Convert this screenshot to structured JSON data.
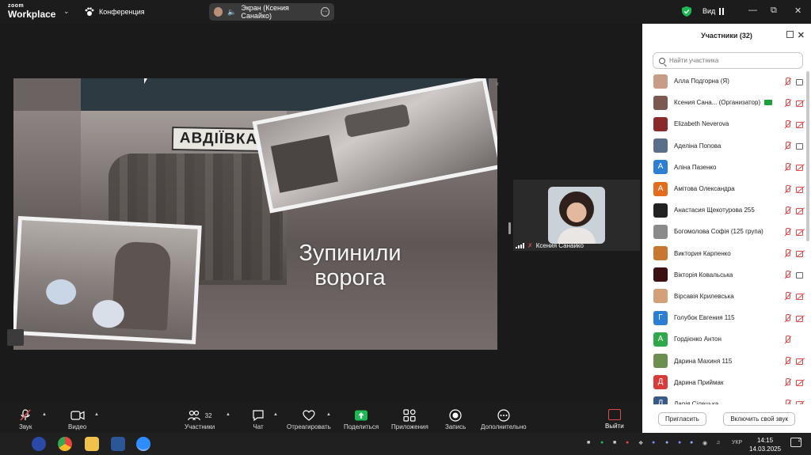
{
  "app": {
    "brand_top": "zoom",
    "brand_bottom": "Workplace",
    "meeting_label": "Конференция",
    "share_label": "Экран (Ксения Санайко)",
    "view_label": "Вид"
  },
  "slide": {
    "sign_text": "АВДІЇВКА",
    "caption_line1": "Зупинили",
    "caption_line2": "ворога"
  },
  "video_tile": {
    "name": "Ксения Санайко"
  },
  "participants": {
    "title": "Участники (32)",
    "search_placeholder": "Найти участника",
    "invite_label": "Пригласить",
    "unmute_label": "Включить свой звук",
    "rows": [
      {
        "name": "Алла Подгорна (Я)",
        "avatar": "",
        "avatar_color": "#c79d87",
        "cam": "on"
      },
      {
        "name": "Ксения Сана... (Организатор)",
        "avatar": "",
        "avatar_color": "#7a5a50",
        "cam": "off",
        "badge": true
      },
      {
        "name": "Elizabeth Neverova",
        "avatar": "",
        "avatar_color": "#8b2a2a",
        "cam": "off"
      },
      {
        "name": "Аделіна Попова",
        "avatar": "",
        "avatar_color": "#5c6f8a",
        "cam": "on"
      },
      {
        "name": "Аліна Пазенко",
        "avatar": "А",
        "avatar_color": "#2d7fd3",
        "cam": "off"
      },
      {
        "name": "Амітова Олександра",
        "avatar": "А",
        "avatar_color": "#e46c1e",
        "cam": "off"
      },
      {
        "name": "Анастасия Щекотурова 255",
        "avatar": "",
        "avatar_color": "#222222",
        "cam": "off"
      },
      {
        "name": "Богомолова Софія (125 група)",
        "avatar": "",
        "avatar_color": "#8a8a8a",
        "cam": "off"
      },
      {
        "name": "Виктория Карпенко",
        "avatar": "",
        "avatar_color": "#c8772e",
        "cam": "off"
      },
      {
        "name": "Вікторія Ковальська",
        "avatar": "",
        "avatar_color": "#3a1010",
        "cam": "on"
      },
      {
        "name": "Вірсавія Крилевська",
        "avatar": "",
        "avatar_color": "#d4a07a",
        "cam": "off"
      },
      {
        "name": "Голубок Евгения 115",
        "avatar": "Г",
        "avatar_color": "#2d7fd3",
        "cam": "off"
      },
      {
        "name": "Гордієнко Антон",
        "avatar": "А",
        "avatar_color": "#2ea84a",
        "cam": "none"
      },
      {
        "name": "Дарина Махиня 115",
        "avatar": "",
        "avatar_color": "#6d8f4e",
        "cam": "off"
      },
      {
        "name": "Дарина Приймак",
        "avatar": "Д",
        "avatar_color": "#d93a3a",
        "cam": "off"
      },
      {
        "name": "Дарія Сілецька",
        "avatar": "Д",
        "avatar_color": "#3a5a8a",
        "cam": "off"
      }
    ]
  },
  "toolbar": {
    "audio": "Звук",
    "video": "Видео",
    "participants": "Участники",
    "participants_count": "32",
    "chat": "Чат",
    "react": "Отреагировать",
    "share": "Поделиться",
    "apps": "Приложения",
    "record": "Запись",
    "more": "Дополнительно",
    "leave": "Выйти"
  },
  "taskbar": {
    "lang": "УКР",
    "time": "14:15",
    "date": "14.03.2025",
    "notif_count": "2"
  },
  "colors": {
    "accent_red": "#e04a4a",
    "share_green": "#1db954",
    "panel_bg": "#ffffff",
    "toolbar_bg": "#1c1c1c"
  }
}
